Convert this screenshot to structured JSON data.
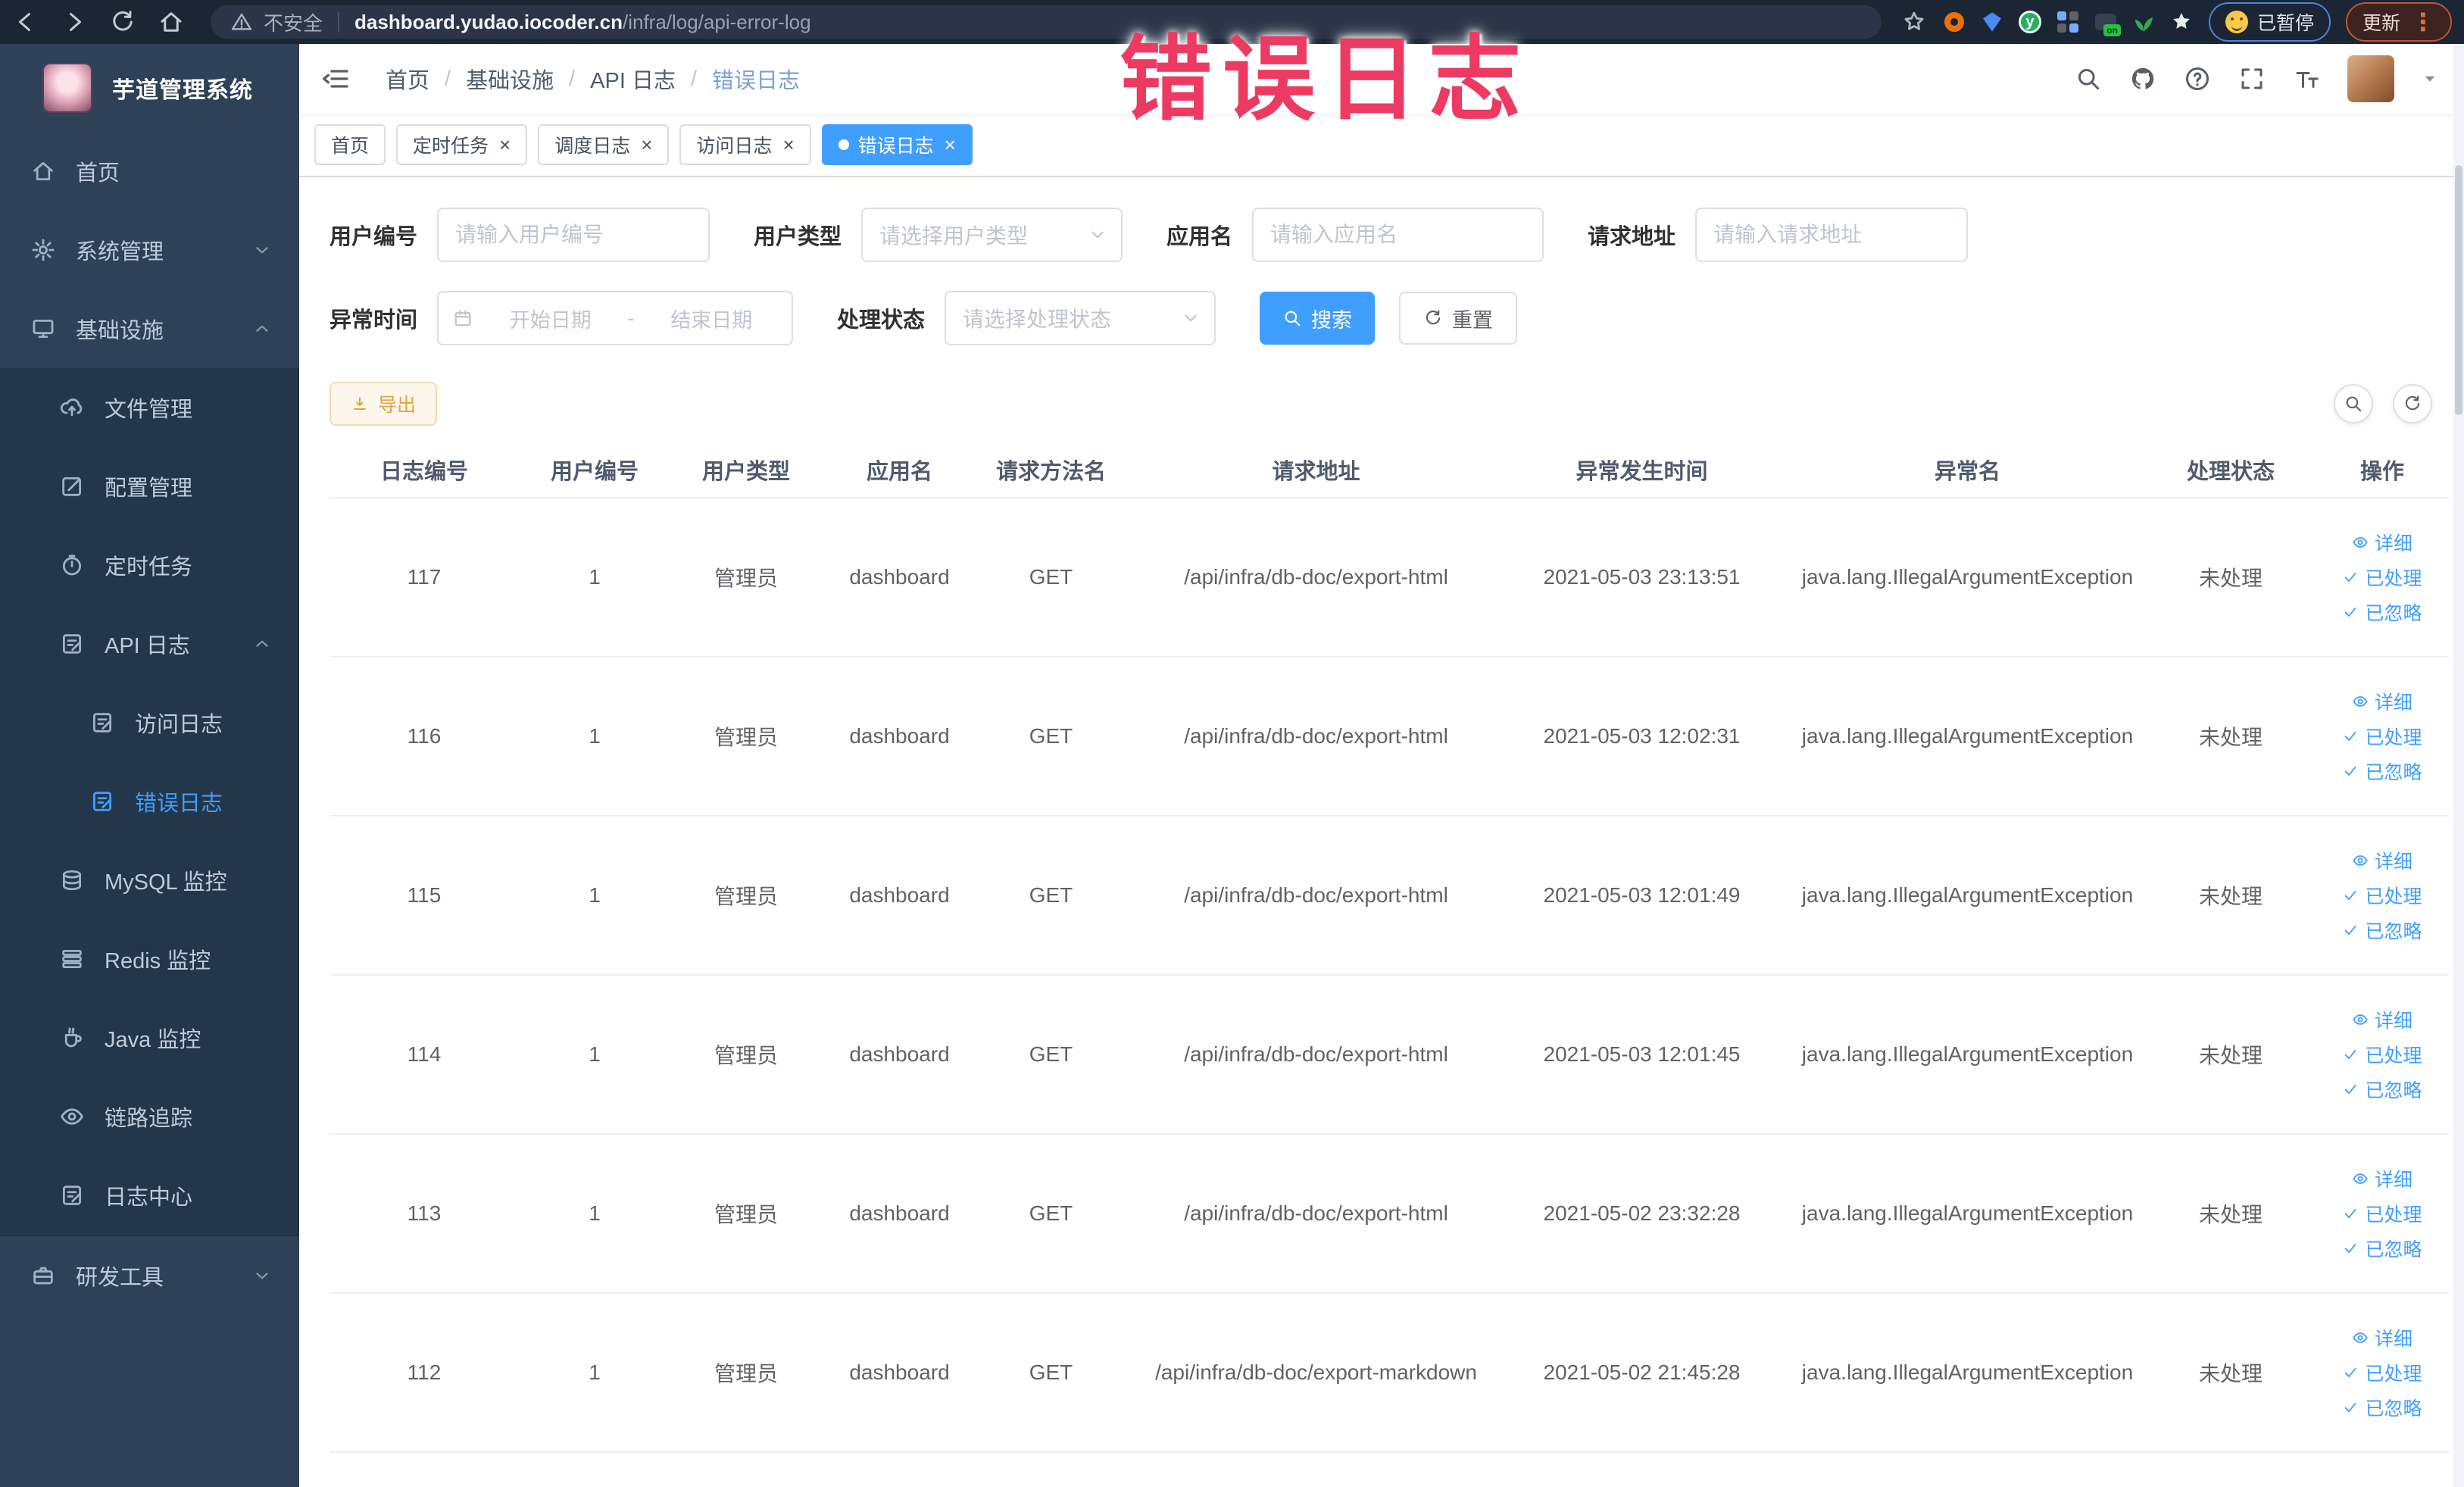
{
  "browser": {
    "security_label": "不安全",
    "url_domain": "dashboard.yudao.iocoder.cn",
    "url_path": "/infra/log/api-error-log",
    "paused_badge": "已暂停",
    "update_button": "更新",
    "extensions": [
      {
        "key": "extension-orange-ring",
        "shape": "ring",
        "color": "#e8710a"
      },
      {
        "key": "extension-blue-kite",
        "shape": "kite",
        "color": "#4b8bf5"
      },
      {
        "key": "extension-green-y",
        "shape": "circle-letter",
        "color": "#27ae60",
        "letter": "y"
      },
      {
        "key": "extension-dot-grid",
        "shape": "grid",
        "color": "#7baaf7"
      },
      {
        "key": "extension-toggle",
        "shape": "toggle",
        "color": "#37404f",
        "badge": "on"
      },
      {
        "key": "extension-leaf",
        "shape": "leaf",
        "color": "#34a853"
      },
      {
        "key": "extension-star",
        "shape": "star",
        "color": "#e8eaed"
      }
    ]
  },
  "annotation": {
    "text": "错误日志",
    "color": "#ed3a62"
  },
  "sidebar": {
    "app_title": "芋道管理系统",
    "items": [
      {
        "key": "home",
        "label": "首页",
        "icon": "home",
        "level": 0
      },
      {
        "key": "system-management",
        "label": "系统管理",
        "icon": "gear",
        "level": 0,
        "chevron": "down"
      },
      {
        "key": "infrastructure",
        "label": "基础设施",
        "icon": "monitor",
        "level": 0,
        "chevron": "up"
      },
      {
        "key": "file-management",
        "label": "文件管理",
        "icon": "cloud-upload",
        "level": 1,
        "dark": true
      },
      {
        "key": "config-management",
        "label": "配置管理",
        "icon": "edit",
        "level": 1,
        "dark": true
      },
      {
        "key": "scheduled-tasks",
        "label": "定时任务",
        "icon": "timer",
        "level": 1,
        "dark": true
      },
      {
        "key": "api-log",
        "label": "API 日志",
        "icon": "doc-edit",
        "level": 1,
        "dark": true,
        "chevron": "up"
      },
      {
        "key": "access-log",
        "label": "访问日志",
        "icon": "doc-edit",
        "level": 2,
        "dark": true
      },
      {
        "key": "error-log",
        "label": "错误日志",
        "icon": "doc-edit",
        "level": 2,
        "dark": true,
        "active": true
      },
      {
        "key": "mysql-monitor",
        "label": "MySQL 监控",
        "icon": "database",
        "level": 1,
        "dark": true
      },
      {
        "key": "redis-monitor",
        "label": "Redis 监控",
        "icon": "layers",
        "level": 1,
        "dark": true
      },
      {
        "key": "java-monitor",
        "label": "Java 监控",
        "icon": "coffee",
        "level": 1,
        "dark": true
      },
      {
        "key": "trace",
        "label": "链路追踪",
        "icon": "eye",
        "level": 1,
        "dark": true
      },
      {
        "key": "log-center",
        "label": "日志中心",
        "icon": "doc-edit",
        "level": 1,
        "dark": true
      },
      {
        "key": "dev-tools",
        "label": "研发工具",
        "icon": "briefcase",
        "level": 0,
        "chevron": "down",
        "divider_before": true
      }
    ]
  },
  "header": {
    "breadcrumb": [
      "首页",
      "基础设施",
      "API 日志",
      "错误日志"
    ],
    "breadcrumb_separator": "/"
  },
  "tabs": [
    {
      "key": "home",
      "label": "首页",
      "closable": false,
      "active": false
    },
    {
      "key": "scheduled-tasks",
      "label": "定时任务",
      "closable": true,
      "active": false
    },
    {
      "key": "schedule-log",
      "label": "调度日志",
      "closable": true,
      "active": false
    },
    {
      "key": "access-log",
      "label": "访问日志",
      "closable": true,
      "active": false
    },
    {
      "key": "error-log",
      "label": "错误日志",
      "closable": true,
      "active": true
    }
  ],
  "filters": {
    "user_id": {
      "label": "用户编号",
      "placeholder": "请输入用户编号"
    },
    "user_type": {
      "label": "用户类型",
      "placeholder": "请选择用户类型"
    },
    "app_name": {
      "label": "应用名",
      "placeholder": "请输入应用名"
    },
    "request_url": {
      "label": "请求地址",
      "placeholder": "请输入请求地址"
    },
    "exception_time": {
      "label": "异常时间",
      "start_placeholder": "开始日期",
      "separator": "-",
      "end_placeholder": "结束日期"
    },
    "process_status": {
      "label": "处理状态",
      "placeholder": "请选择处理状态"
    },
    "search_button": "搜索",
    "reset_button": "重置"
  },
  "toolbar": {
    "export_button": "导出"
  },
  "table": {
    "columns": [
      "日志编号",
      "用户编号",
      "用户类型",
      "应用名",
      "请求方法名",
      "请求地址",
      "异常发生时间",
      "异常名",
      "处理状态",
      "操作"
    ],
    "rows": [
      {
        "id": "117",
        "user_id": "1",
        "user_type": "管理员",
        "app": "dashboard",
        "method": "GET",
        "url": "/api/infra/db-doc/export-html",
        "time": "2021-05-03 23:13:51",
        "exception": "java.lang.IllegalArgumentException",
        "status": "未处理"
      },
      {
        "id": "116",
        "user_id": "1",
        "user_type": "管理员",
        "app": "dashboard",
        "method": "GET",
        "url": "/api/infra/db-doc/export-html",
        "time": "2021-05-03 12:02:31",
        "exception": "java.lang.IllegalArgumentException",
        "status": "未处理"
      },
      {
        "id": "115",
        "user_id": "1",
        "user_type": "管理员",
        "app": "dashboard",
        "method": "GET",
        "url": "/api/infra/db-doc/export-html",
        "time": "2021-05-03 12:01:49",
        "exception": "java.lang.IllegalArgumentException",
        "status": "未处理"
      },
      {
        "id": "114",
        "user_id": "1",
        "user_type": "管理员",
        "app": "dashboard",
        "method": "GET",
        "url": "/api/infra/db-doc/export-html",
        "time": "2021-05-03 12:01:45",
        "exception": "java.lang.IllegalArgumentException",
        "status": "未处理"
      },
      {
        "id": "113",
        "user_id": "1",
        "user_type": "管理员",
        "app": "dashboard",
        "method": "GET",
        "url": "/api/infra/db-doc/export-html",
        "time": "2021-05-02 23:32:28",
        "exception": "java.lang.IllegalArgumentException",
        "status": "未处理"
      },
      {
        "id": "112",
        "user_id": "1",
        "user_type": "管理员",
        "app": "dashboard",
        "method": "GET",
        "url": "/api/infra/db-doc/export-markdown",
        "time": "2021-05-02 21:45:28",
        "exception": "java.lang.IllegalArgumentException",
        "status": "未处理"
      }
    ],
    "actions": [
      {
        "label": "详细",
        "icon": "view"
      },
      {
        "label": "已处理",
        "icon": "check"
      },
      {
        "label": "已忽略",
        "icon": "check"
      }
    ]
  },
  "colors": {
    "accent": "#409eff",
    "annotation": "#ed3a62",
    "warning_text": "#e6a23c",
    "warning_bg": "#fdf6ec",
    "warning_border": "#f5dab1"
  }
}
